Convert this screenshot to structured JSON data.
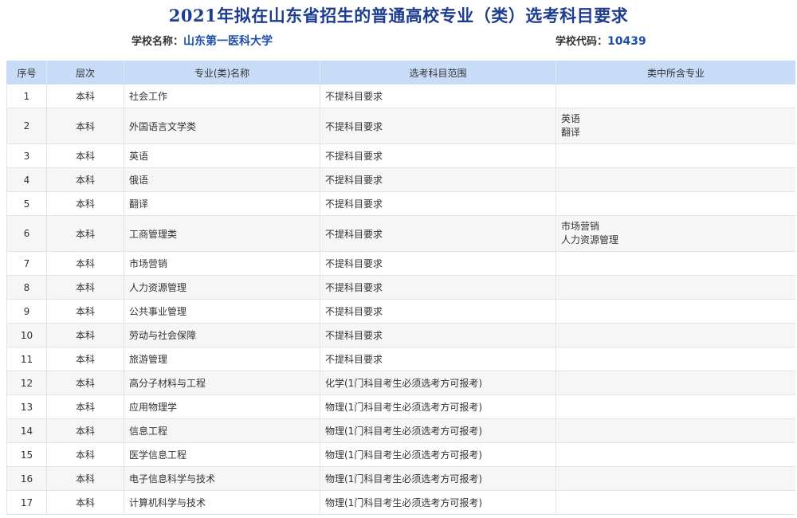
{
  "page": {
    "title": "2021年拟在山东省招生的普通高校专业（类）选考科目要求",
    "school_name_label": "学校名称：",
    "school_name": "山东第一医科大学",
    "school_code_label": "学校代码：",
    "school_code": "10439"
  },
  "table": {
    "headers": [
      "序号",
      "层次",
      "专业(类)名称",
      "选考科目范围",
      "类中所含专业"
    ],
    "rows": [
      {
        "no": "1",
        "level": "本科",
        "major": "社会工作",
        "subjects": "不提科目要求",
        "included": []
      },
      {
        "no": "2",
        "level": "本科",
        "major": "外国语言文学类",
        "subjects": "不提科目要求",
        "included": [
          "英语",
          "翻译"
        ]
      },
      {
        "no": "3",
        "level": "本科",
        "major": "英语",
        "subjects": "不提科目要求",
        "included": []
      },
      {
        "no": "4",
        "level": "本科",
        "major": "俄语",
        "subjects": "不提科目要求",
        "included": []
      },
      {
        "no": "5",
        "level": "本科",
        "major": "翻译",
        "subjects": "不提科目要求",
        "included": []
      },
      {
        "no": "6",
        "level": "本科",
        "major": "工商管理类",
        "subjects": "不提科目要求",
        "included": [
          "市场营销",
          "人力资源管理"
        ]
      },
      {
        "no": "7",
        "level": "本科",
        "major": "市场营销",
        "subjects": "不提科目要求",
        "included": []
      },
      {
        "no": "8",
        "level": "本科",
        "major": "人力资源管理",
        "subjects": "不提科目要求",
        "included": []
      },
      {
        "no": "9",
        "level": "本科",
        "major": "公共事业管理",
        "subjects": "不提科目要求",
        "included": []
      },
      {
        "no": "10",
        "level": "本科",
        "major": "劳动与社会保障",
        "subjects": "不提科目要求",
        "included": []
      },
      {
        "no": "11",
        "level": "本科",
        "major": "旅游管理",
        "subjects": "不提科目要求",
        "included": []
      },
      {
        "no": "12",
        "level": "本科",
        "major": "高分子材料与工程",
        "subjects": "化学(1门科目考生必须选考方可报考)",
        "included": []
      },
      {
        "no": "13",
        "level": "本科",
        "major": "应用物理学",
        "subjects": "物理(1门科目考生必须选考方可报考)",
        "included": []
      },
      {
        "no": "14",
        "level": "本科",
        "major": "信息工程",
        "subjects": "物理(1门科目考生必须选考方可报考)",
        "included": []
      },
      {
        "no": "15",
        "level": "本科",
        "major": "医学信息工程",
        "subjects": "物理(1门科目考生必须选考方可报考)",
        "included": []
      },
      {
        "no": "16",
        "level": "本科",
        "major": "电子信息科学与技术",
        "subjects": "物理(1门科目考生必须选考方可报考)",
        "included": []
      },
      {
        "no": "17",
        "level": "本科",
        "major": "计算机科学与技术",
        "subjects": "物理(1门科目考生必须选考方可报考)",
        "included": []
      }
    ]
  }
}
